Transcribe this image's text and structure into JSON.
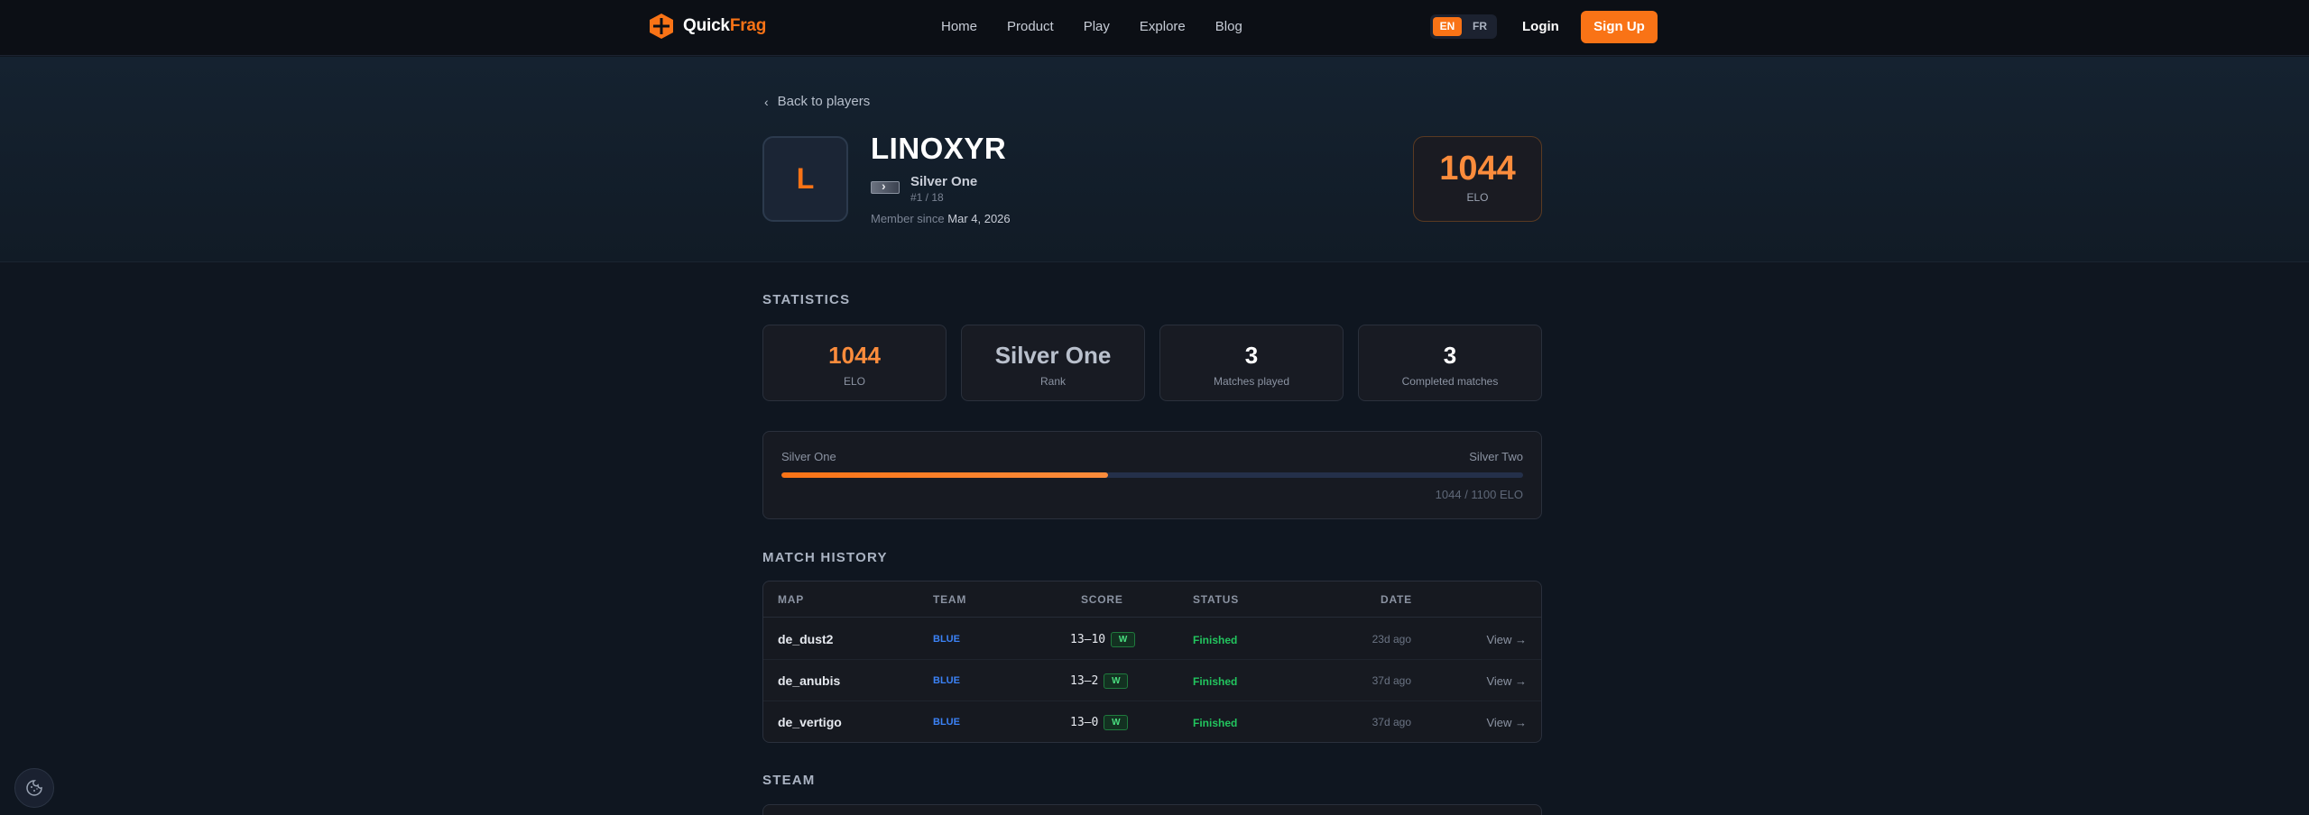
{
  "nav": {
    "brand_a": "Quick",
    "brand_b": "Frag",
    "links": [
      "Home",
      "Product",
      "Play",
      "Explore",
      "Blog"
    ],
    "lang_en": "EN",
    "lang_fr": "FR",
    "login": "Login",
    "signup": "Sign Up"
  },
  "profile": {
    "back": "Back to players",
    "initial": "L",
    "name": "LINOXYR",
    "rank": "Silver One",
    "rank_position": "#1 / 18",
    "member_label": "Member since",
    "member_date": "Mar 4, 2026",
    "elo_value": "1044",
    "elo_label": "ELO"
  },
  "statistics": {
    "title": "STATISTICS",
    "cards": [
      {
        "value": "1044",
        "label": "ELO"
      },
      {
        "value": "Silver One",
        "label": "Rank"
      },
      {
        "value": "3",
        "label": "Matches played"
      },
      {
        "value": "3",
        "label": "Completed matches"
      }
    ],
    "progress": {
      "from": "Silver One",
      "to": "Silver Two",
      "text": "1044 / 1100 ELO",
      "fraction": 0.44
    }
  },
  "match_history": {
    "title": "MATCH HISTORY",
    "headers": [
      "MAP",
      "TEAM",
      "SCORE",
      "STATUS",
      "DATE"
    ],
    "rows": [
      {
        "map": "de_dust2",
        "team": "BLUE",
        "score": "13–10",
        "result": "W",
        "status": "Finished",
        "date": "23d ago",
        "view": "View →"
      },
      {
        "map": "de_anubis",
        "team": "BLUE",
        "score": "13–2",
        "result": "W",
        "status": "Finished",
        "date": "37d ago",
        "view": "View →"
      },
      {
        "map": "de_vertigo",
        "team": "BLUE",
        "score": "13–0",
        "result": "W",
        "status": "Finished",
        "date": "37d ago",
        "view": "View →"
      }
    ]
  },
  "steam": {
    "title": "STEAM"
  },
  "colors": {
    "accent": "#f97316",
    "team_blue": "#3b82f6",
    "status_finished": "#22c55e",
    "background": "#0f1620"
  },
  "icons": {
    "logo": "quickfrag-logo-icon",
    "back": "chevron-left-icon",
    "cookie": "cookie-icon"
  }
}
